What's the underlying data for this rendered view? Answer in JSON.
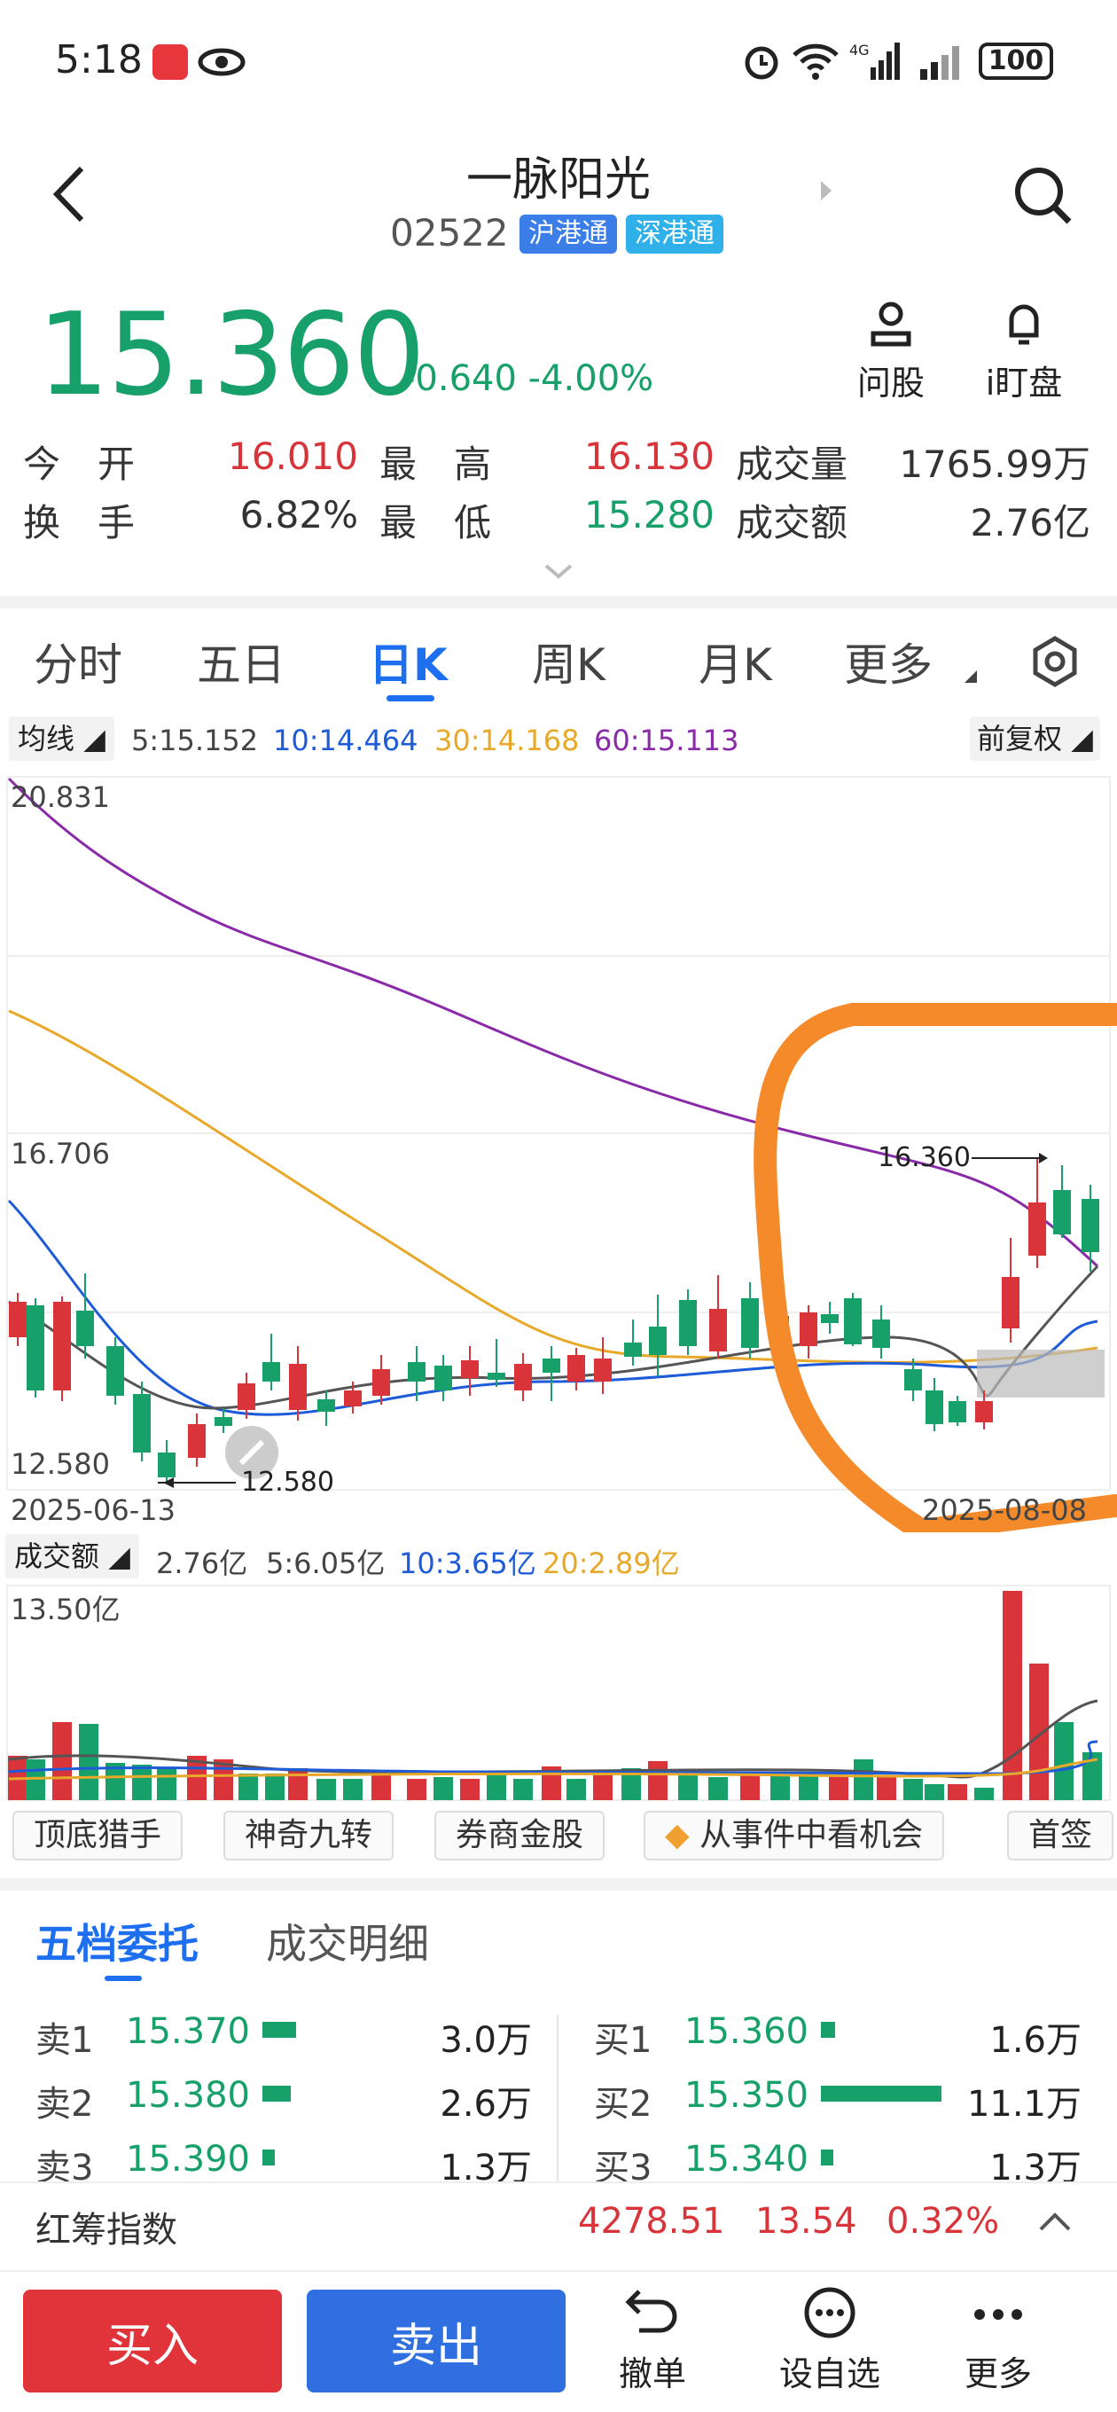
{
  "status_bar": {
    "time": "5:18",
    "battery": "100"
  },
  "header": {
    "title": "一脉阳光",
    "code": "02522",
    "badges": [
      "沪港通",
      "深港通"
    ]
  },
  "quote": {
    "price": "15.360",
    "change": "-0.640",
    "change_pct": "-4.00%",
    "actions": [
      "问股",
      "i盯盘"
    ]
  },
  "stats": {
    "open_label": "今　开",
    "open": "16.010",
    "high_label": "最　高",
    "high": "16.130",
    "volume_label": "成交量",
    "volume": "1765.99万",
    "turnover_label": "换　手",
    "turnover": "6.82%",
    "low_label": "最　低",
    "low": "15.280",
    "amount_label": "成交额",
    "amount": "2.76亿"
  },
  "chart_tabs": [
    "分时",
    "五日",
    "日K",
    "周K",
    "月K",
    "更多"
  ],
  "active_tab": "日K",
  "ma_bar": {
    "selector": "均线",
    "ma5": "5:15.152",
    "ma10": "10:14.464",
    "ma30": "30:14.168",
    "ma60": "60:15.113",
    "adjust": "前复权"
  },
  "kline": {
    "y_top_label": "20.831",
    "y_mid_label": "16.706",
    "y_bottom_label": "12.580",
    "high_annotation": "16.360",
    "low_annotation": "12.580",
    "start_date": "2025-06-13",
    "end_date": "2025-08-08"
  },
  "volume_bar": {
    "selector": "成交额",
    "value": "2.76亿",
    "ma5": "5:6.05亿",
    "ma10": "10:3.65亿",
    "ma20": "20:2.89亿",
    "y_top_label": "13.50亿"
  },
  "feature_chips": [
    "顶底猎手",
    "神奇九转",
    "券商金股",
    "从事件中看机会",
    "首签"
  ],
  "orderbook": {
    "tabs": [
      "五档委托",
      "成交明细"
    ],
    "sell": [
      {
        "label": "卖1",
        "price": "15.370",
        "qty": "3.0万"
      },
      {
        "label": "卖2",
        "price": "15.380",
        "qty": "2.6万"
      },
      {
        "label": "卖3",
        "price": "15.390",
        "qty": "1.3万"
      }
    ],
    "buy": [
      {
        "label": "买1",
        "price": "15.360",
        "qty": "1.6万"
      },
      {
        "label": "买2",
        "price": "15.350",
        "qty": "11.1万"
      },
      {
        "label": "买3",
        "price": "15.340",
        "qty": "1.3万"
      }
    ]
  },
  "index_bar": {
    "name": "红筹指数",
    "value": "4278.51",
    "change": "13.54",
    "pct": "0.32%"
  },
  "bottom_bar": {
    "buy": "买入",
    "sell": "卖出",
    "cancel": "撤单",
    "watch": "设自选",
    "more": "更多"
  },
  "colors": {
    "up": "#d8343a",
    "down": "#17a06a",
    "ma5": "#555555",
    "ma10": "#1e5bd8",
    "ma30": "#e8a92a",
    "ma60": "#8a2aa8",
    "annotation": "#f58a2a"
  }
}
